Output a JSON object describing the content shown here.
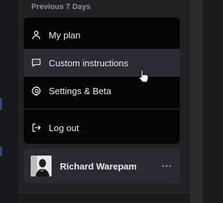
{
  "sidebar": {
    "section_heading": "Previous 7 Days"
  },
  "menu": {
    "items": [
      {
        "label": "My plan",
        "icon": "user-icon"
      },
      {
        "label": "Custom instructions",
        "icon": "chat-bubble-icon",
        "state": "hovered"
      },
      {
        "label": "Settings & Beta",
        "icon": "gear-icon"
      },
      {
        "label": "Log out",
        "icon": "logout-icon"
      }
    ]
  },
  "user": {
    "name": "Richard Warepam",
    "more_icon": "ellipsis-icon"
  },
  "colors": {
    "menu_bg": "#050506",
    "hover_bg": "#2a2b33",
    "text": "#ececf1",
    "heading": "#8e8ea0",
    "user_card_bg": "#2a2b32"
  }
}
